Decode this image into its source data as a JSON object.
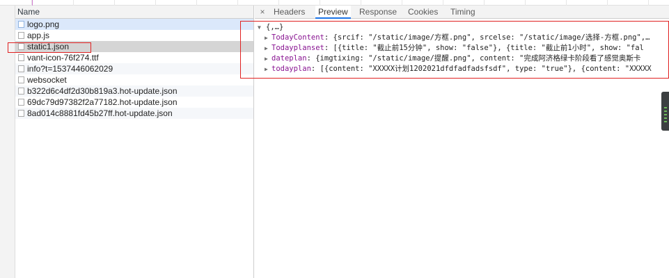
{
  "requests": {
    "header": "Name",
    "items": [
      {
        "name": "logo.png"
      },
      {
        "name": "app.js"
      },
      {
        "name": "static1.json"
      },
      {
        "name": "vant-icon-76f274.ttf"
      },
      {
        "name": "info?t=1537446062029"
      },
      {
        "name": "websocket"
      },
      {
        "name": "b322d6c4df2d30b819a3.hot-update.json"
      },
      {
        "name": "69dc79d97382f2a77182.hot-update.json"
      },
      {
        "name": "8ad014c8881fd45b27ff.hot-update.json"
      }
    ],
    "selected": "static1.json"
  },
  "detail": {
    "close": "×",
    "tabs": {
      "headers": "Headers",
      "preview": "Preview",
      "response": "Response",
      "cookies": "Cookies",
      "timing": "Timing"
    },
    "active_tab": "Preview"
  },
  "preview": {
    "root": "{,…}",
    "rows": [
      {
        "key": "TodayContent",
        "value": "{srcif: \"/static/image/方框.png\", srcelse: \"/static/image/选择-方框.png\",…"
      },
      {
        "key": "Todayplanset",
        "value": "[{title: \"截止前15分钟\", show: \"false\"}, {title: \"截止前1小时\", show: \"fal"
      },
      {
        "key": "dateplan",
        "value": "{imgtixing: \"/static/image/提醒.png\", content: \"完成阿济格绿卡阶段看了感觉奥斯卡"
      },
      {
        "key": "todayplan",
        "value": "[{content: \"XXXXX计划1202021dfdfadfadsfsdf\", type: \"true\"}, {content: \"XXXXX"
      }
    ]
  },
  "icons": {
    "expanded": "triangle-down-icon",
    "collapsed": "triangle-right-icon",
    "file": "file-icon"
  }
}
